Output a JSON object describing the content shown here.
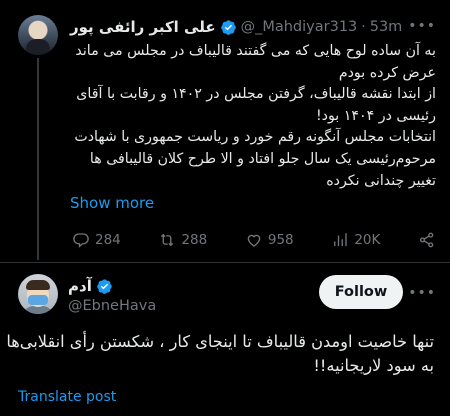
{
  "tweet1": {
    "display_name": "علی اکبر رائفی پور",
    "handle": "@_Mahdiyar313",
    "separator": "·",
    "time": "53m",
    "body_lines": [
      "به آن ساده لوح هایی که می گفتند قالیباف در مجلس می ماند",
      "عرض کرده بودم",
      "از ابتدا نقشه قالیباف، گرفتن مجلس در ۱۴۰۲ و رقابت با آقای",
      "رئیسی در ۱۴۰۴ بود!",
      "انتخابات مجلس آنگونه رقم خورد و ریاست جمهوری با شهادت",
      "مرحوم‌رئیسی یک سال جلو افتاد و الا طرح کلان قالیبافی ها",
      "تغییر چندانی نکرده"
    ],
    "show_more": "Show more",
    "actions": {
      "replies": "284",
      "retweets": "288",
      "likes": "958",
      "views": "20K"
    }
  },
  "tweet2": {
    "display_name": "آدم",
    "handle": "@EbneHava",
    "follow_label": "Follow",
    "body_lines": [
      "تنها خاصیت اومدن قالیباف تا اینجای کار ، شکستن رأی انقلابی‌ها",
      "به سود لاریجانیه!!"
    ],
    "translate": "Translate post"
  },
  "colors": {
    "background": "#000000",
    "accent": "#1d9bf0",
    "muted": "#71767b",
    "text": "#e7e9ea"
  }
}
